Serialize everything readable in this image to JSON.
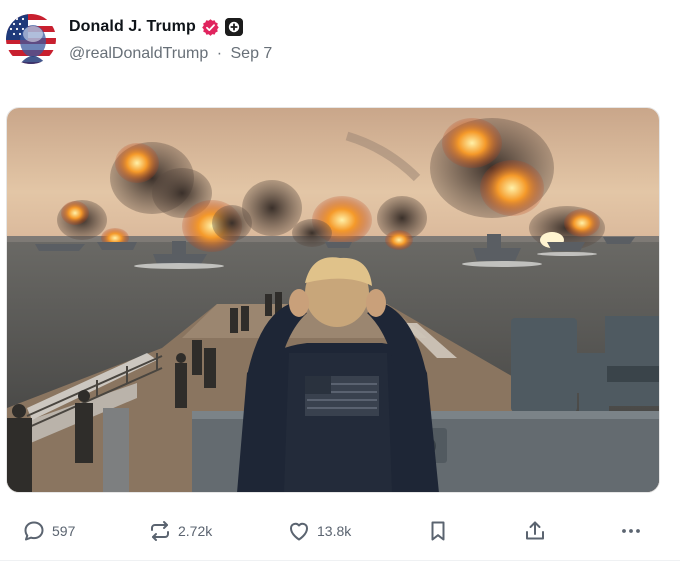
{
  "post": {
    "author": {
      "display_name": "Donald J. Trump",
      "handle": "@realDonaldTrump",
      "separator": "·",
      "date": "Sep 7",
      "verified_icon": "verified-badge-icon",
      "plus_icon": "plus-badge-icon",
      "verified_color": "#e0245e"
    },
    "media": {
      "type": "image",
      "icon": "photo"
    },
    "actions": {
      "replies": "597",
      "reposts": "2.72k",
      "likes": "13.8k"
    }
  },
  "icons": {
    "reply": "comment-bubble-icon",
    "repost": "repost-arrows-icon",
    "like": "heart-icon",
    "bookmark": "bookmark-icon",
    "share": "share-upload-icon",
    "more": "ellipsis-icon"
  },
  "colors": {
    "text_primary": "#0f1419",
    "text_secondary": "#687078",
    "icon": "#5b6470"
  }
}
